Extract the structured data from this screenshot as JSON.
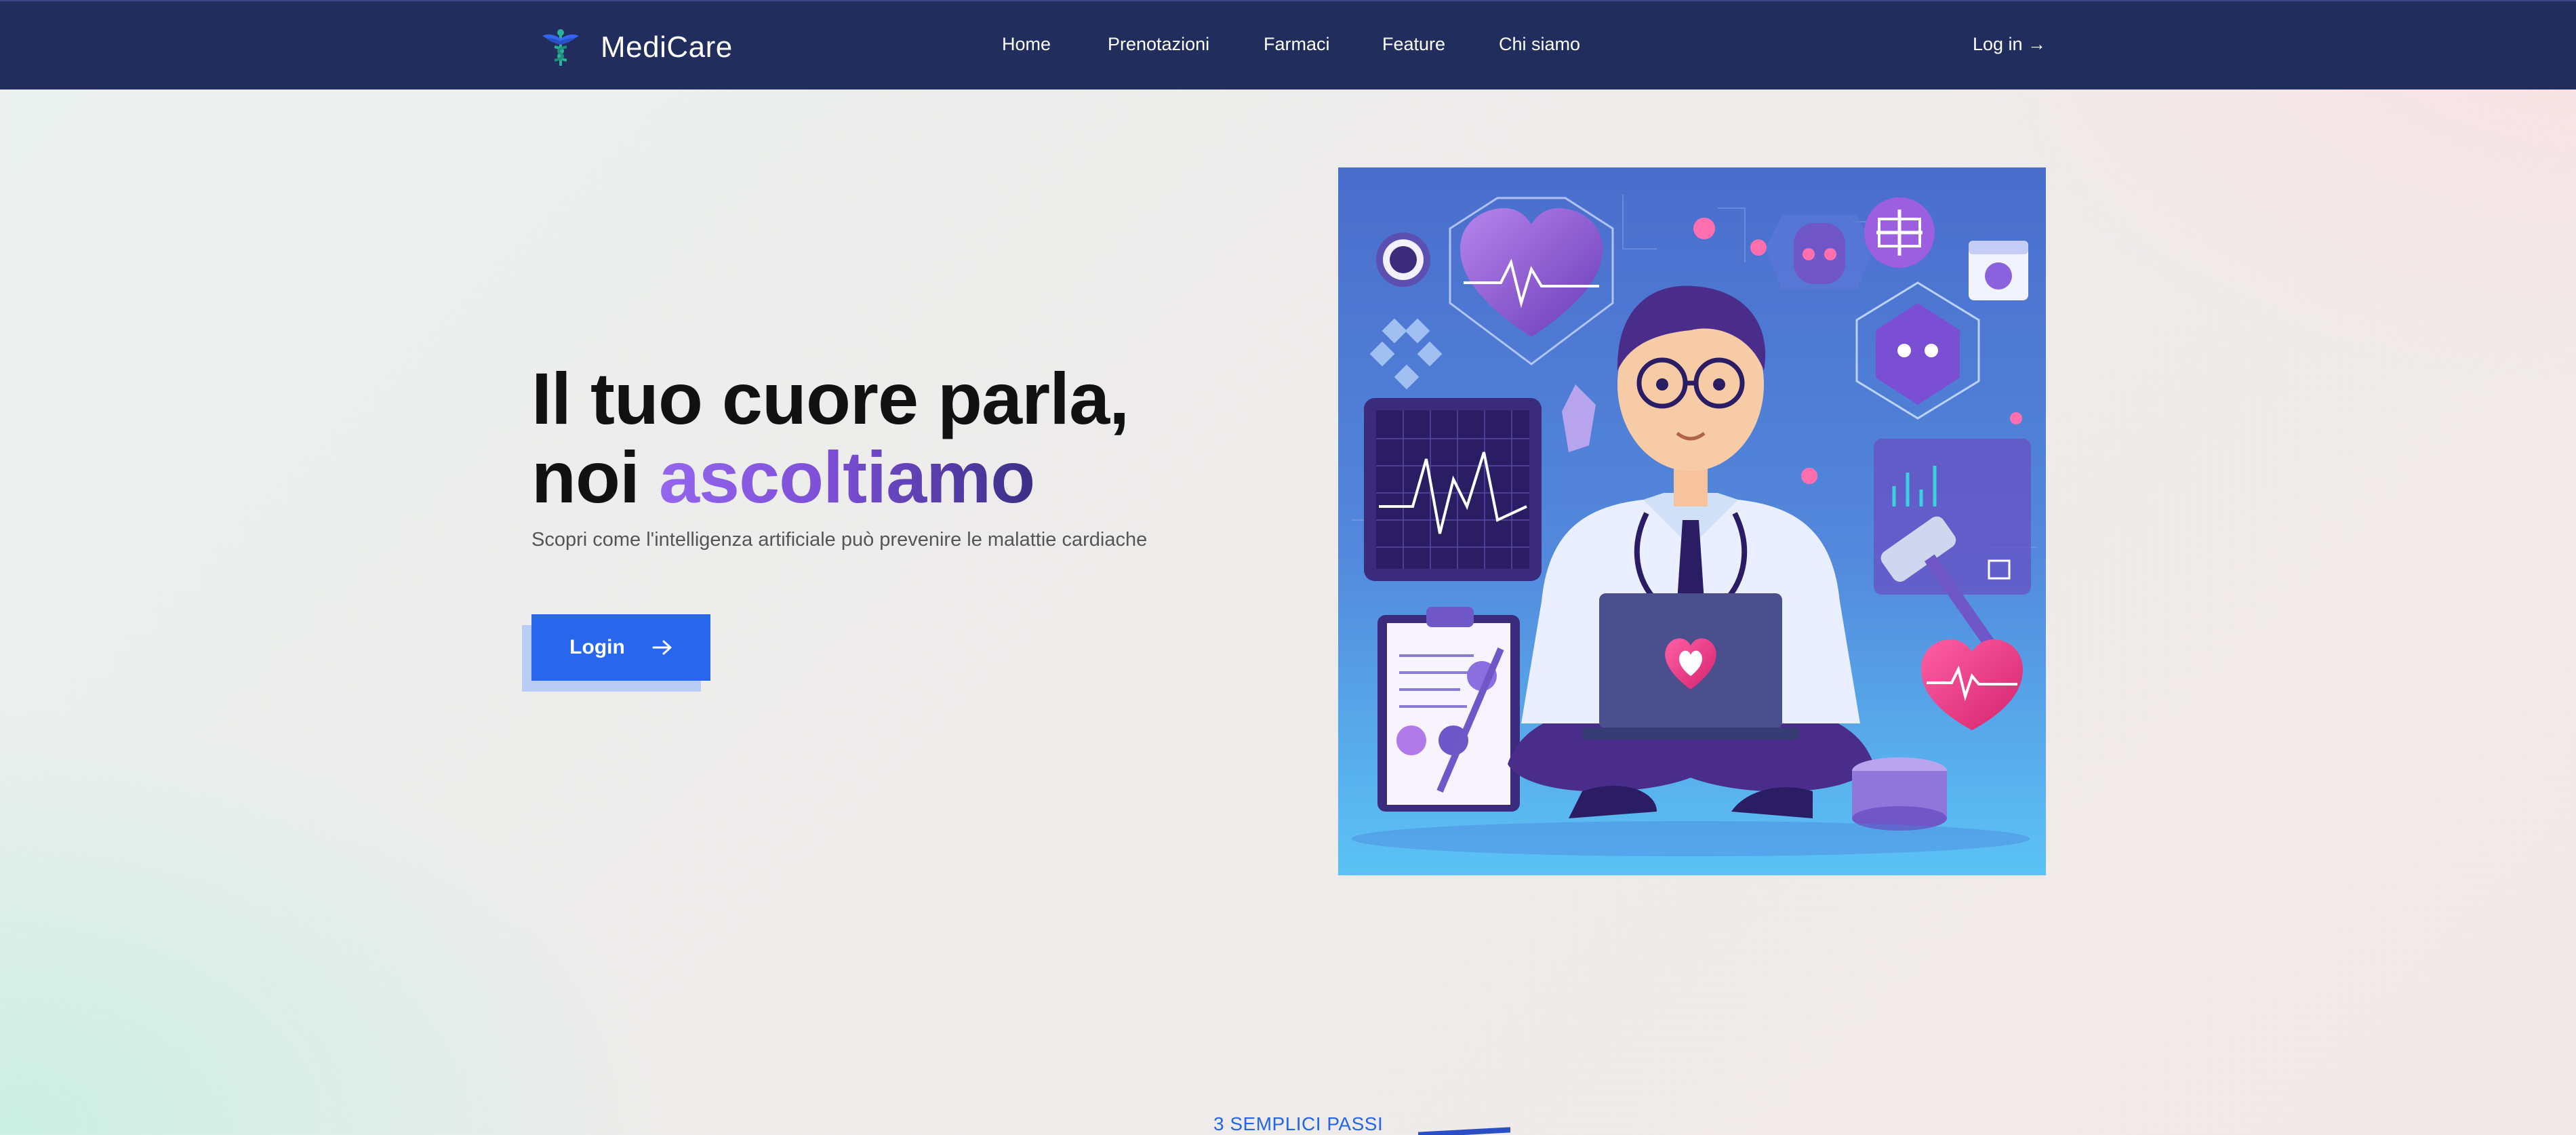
{
  "navbar": {
    "brand_name": "MediCare",
    "brand_icon": "caduceus-icon",
    "links": [
      {
        "label": "Home"
      },
      {
        "label": "Prenotazioni"
      },
      {
        "label": "Farmaci"
      },
      {
        "label": "Feature"
      },
      {
        "label": "Chi siamo"
      }
    ],
    "login_label": "Log in →"
  },
  "hero": {
    "title_line1": "Il tuo cuore parla,",
    "title_line2_plain": "noi ",
    "title_line2_accent": "ascoltiamo",
    "subtitle": "Scopri come l'intelligenza artificiale può prevenire le malattie cardiache",
    "cta_label": "Login",
    "cta_icon": "arrow-right-icon",
    "image_subject": "doctor-with-laptop-illustration"
  },
  "steps": {
    "label": "3 SEMPLICI PASSI"
  },
  "colors": {
    "navbar_bg": "#212e5d",
    "primary_button": "#2866ed",
    "accent_gradient_start": "#9566ee",
    "accent_gradient_end": "#3a2f86",
    "steps_label": "#2466e4"
  }
}
